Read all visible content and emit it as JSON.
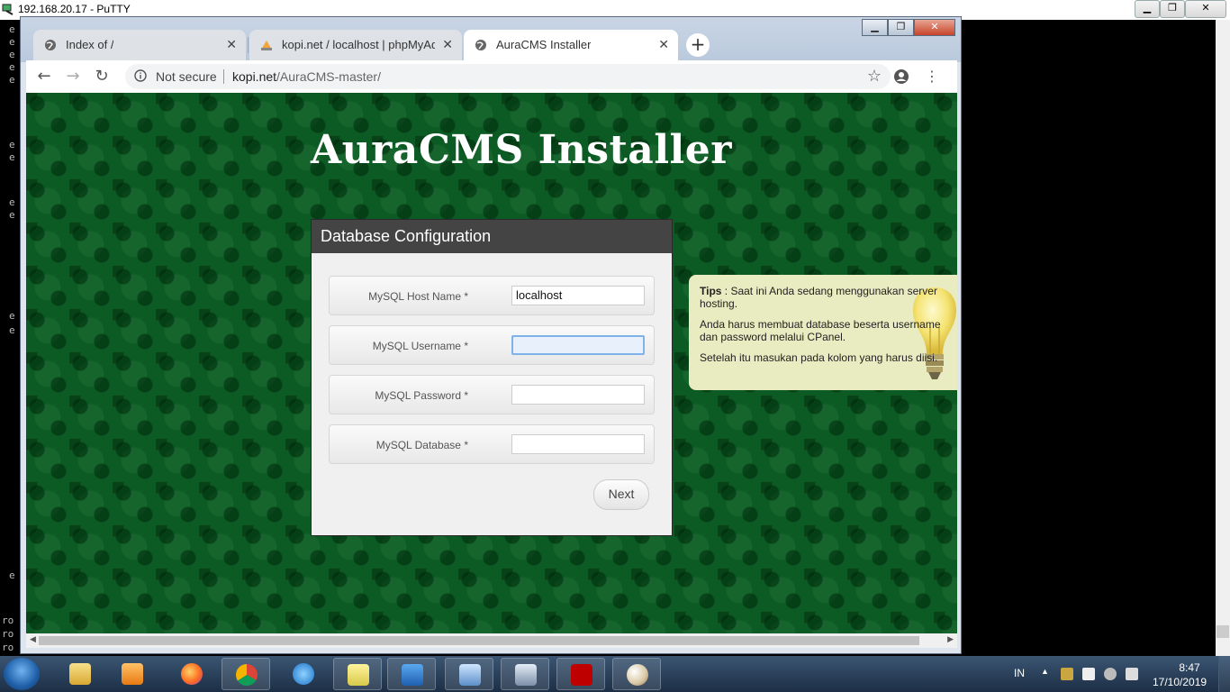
{
  "putty": {
    "title": "192.168.20.17 - PuTTY",
    "left_chars": [
      "e",
      "e",
      "e",
      "e",
      "e",
      "e",
      "e",
      "e",
      "e",
      "e",
      "e",
      "e",
      "e",
      "ro",
      "ro",
      "ro"
    ]
  },
  "browser": {
    "tabs": [
      {
        "label": "Index of /",
        "icon": "globe-icon"
      },
      {
        "label": "kopi.net / localhost | phpMyAdm",
        "icon": "phpmyadmin-icon"
      },
      {
        "label": "AuraCMS Installer",
        "icon": "globe-icon"
      }
    ],
    "new_tab": "+",
    "address": {
      "security": "Not secure",
      "host": "kopi.net",
      "path": "/AuraCMS-master/"
    }
  },
  "page": {
    "title": "AuraCMS Installer",
    "panel_title": "Database Configuration",
    "fields": [
      {
        "label": "MySQL Host Name *",
        "value": "localhost"
      },
      {
        "label": "MySQL Username *",
        "value": ""
      },
      {
        "label": "MySQL Password *",
        "value": ""
      },
      {
        "label": "MySQL Database *",
        "value": ""
      }
    ],
    "next_label": "Next",
    "tips": {
      "heading": "Tips",
      "line1": " : Saat ini Anda sedang menggunakan server hosting.",
      "line2": "Anda harus membuat database beserta username dan password melalui CPanel.",
      "line3": "Setelah itu masukan pada kolom yang harus diisi."
    }
  },
  "taskbar": {
    "apps": [
      "explorer-icon",
      "media-player-icon",
      "firefox-icon",
      "chrome-icon",
      "ie-icon",
      "notes-icon",
      "outlook-icon",
      "remote-desktop-icon",
      "putty-icon",
      "filezilla-icon",
      "paint-icon"
    ],
    "lang": "IN",
    "time": "8:47",
    "date": "17/10/2019"
  },
  "colors": {
    "page_bg": "#0c5a24",
    "panel_head": "#444444",
    "tips_bg": "#e9ebc0"
  }
}
